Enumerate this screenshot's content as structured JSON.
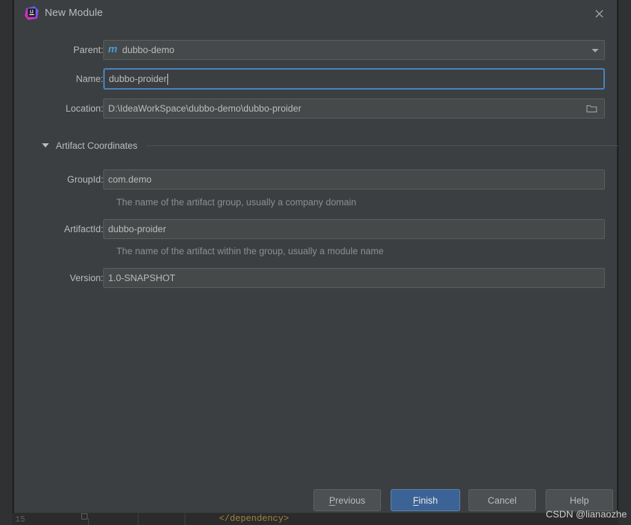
{
  "window": {
    "title": "New Module",
    "logo_icon": "intellij-idea-logo",
    "close_icon": "close-icon"
  },
  "form": {
    "parent": {
      "label": "Parent:",
      "value": "dubbo-demo",
      "icon": "maven-module-icon",
      "dropdown_icon": "chevron-down-icon"
    },
    "name": {
      "label": "Name:",
      "value": "dubbo-proider",
      "focused": true
    },
    "location": {
      "label": "Location:",
      "value": "D:\\IdeaWorkSpace\\dubbo-demo\\dubbo-proider",
      "browse_icon": "folder-icon"
    }
  },
  "artifact_section": {
    "title": "Artifact Coordinates",
    "expanded": true,
    "collapse_icon": "triangle-down-icon",
    "group_id": {
      "label": "GroupId:",
      "value": "com.demo",
      "hint": "The name of the artifact group, usually a company domain"
    },
    "artifact_id": {
      "label": "ArtifactId:",
      "value": "dubbo-proider",
      "hint": "The name of the artifact within the group, usually a module name"
    },
    "version": {
      "label": "Version:",
      "value": "1.0-SNAPSHOT"
    }
  },
  "buttons": {
    "previous": {
      "label": "Previous",
      "mnemonic": "P"
    },
    "finish": {
      "label": "Finish",
      "mnemonic": "F",
      "primary": true
    },
    "cancel": {
      "label": "Cancel"
    },
    "help": {
      "label": "Help"
    }
  },
  "background": {
    "line_number": "15",
    "code": "</dependency>"
  },
  "watermark": "CSDN @lianaozhe",
  "colors": {
    "dialog_bg": "#3c3f41",
    "field_bg": "#45494a",
    "text": "#bbbbbb",
    "hint_text": "#8a8f91",
    "focus_border": "#4a88c7",
    "primary_button": "#3c6395",
    "code_orange": "#a1833c"
  }
}
